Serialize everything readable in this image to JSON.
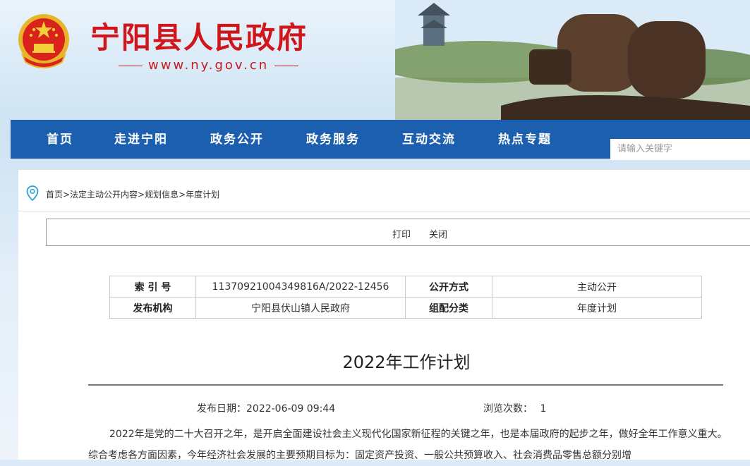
{
  "header": {
    "site_title": "宁阳县人民政府",
    "site_url": "www.ny.gov.cn"
  },
  "nav": {
    "items": [
      "首页",
      "走进宁阳",
      "政务公开",
      "政务服务",
      "互动交流",
      "热点专题"
    ]
  },
  "search": {
    "placeholder": "请输入关键字"
  },
  "breadcrumb": {
    "text": "首页>法定主动公开内容>规划信息>年度计划"
  },
  "toolbar": {
    "print_label": "打印",
    "close_label": "关闭"
  },
  "meta": {
    "index_label": "索 引 号",
    "index_value": "11370921004349816A/2022-12456",
    "open_mode_label": "公开方式",
    "open_mode_value": "主动公开",
    "publisher_label": "发布机构",
    "publisher_value": "宁阳县伏山镇人民政府",
    "category_label": "组配分类",
    "category_value": "年度计划"
  },
  "document": {
    "title": "2022年工作计划",
    "pub_date_label": "发布日期：",
    "pub_date": "2022-06-09 09:44",
    "views_label": "浏览次数：",
    "views": "1",
    "paragraph": "2022年是党的二十大召开之年，是开启全面建设社会主义现代化国家新征程的关键之年，也是本届政府的起步之年，做好全年工作意义重大。综合考虑各方面因素，今年经济社会发展的主要预期目标为：固定资产投资、一般公共预算收入、社会消费品零售总额分别增"
  },
  "colors": {
    "brand_red": "#d0161b",
    "nav_blue": "#1c5fae"
  }
}
